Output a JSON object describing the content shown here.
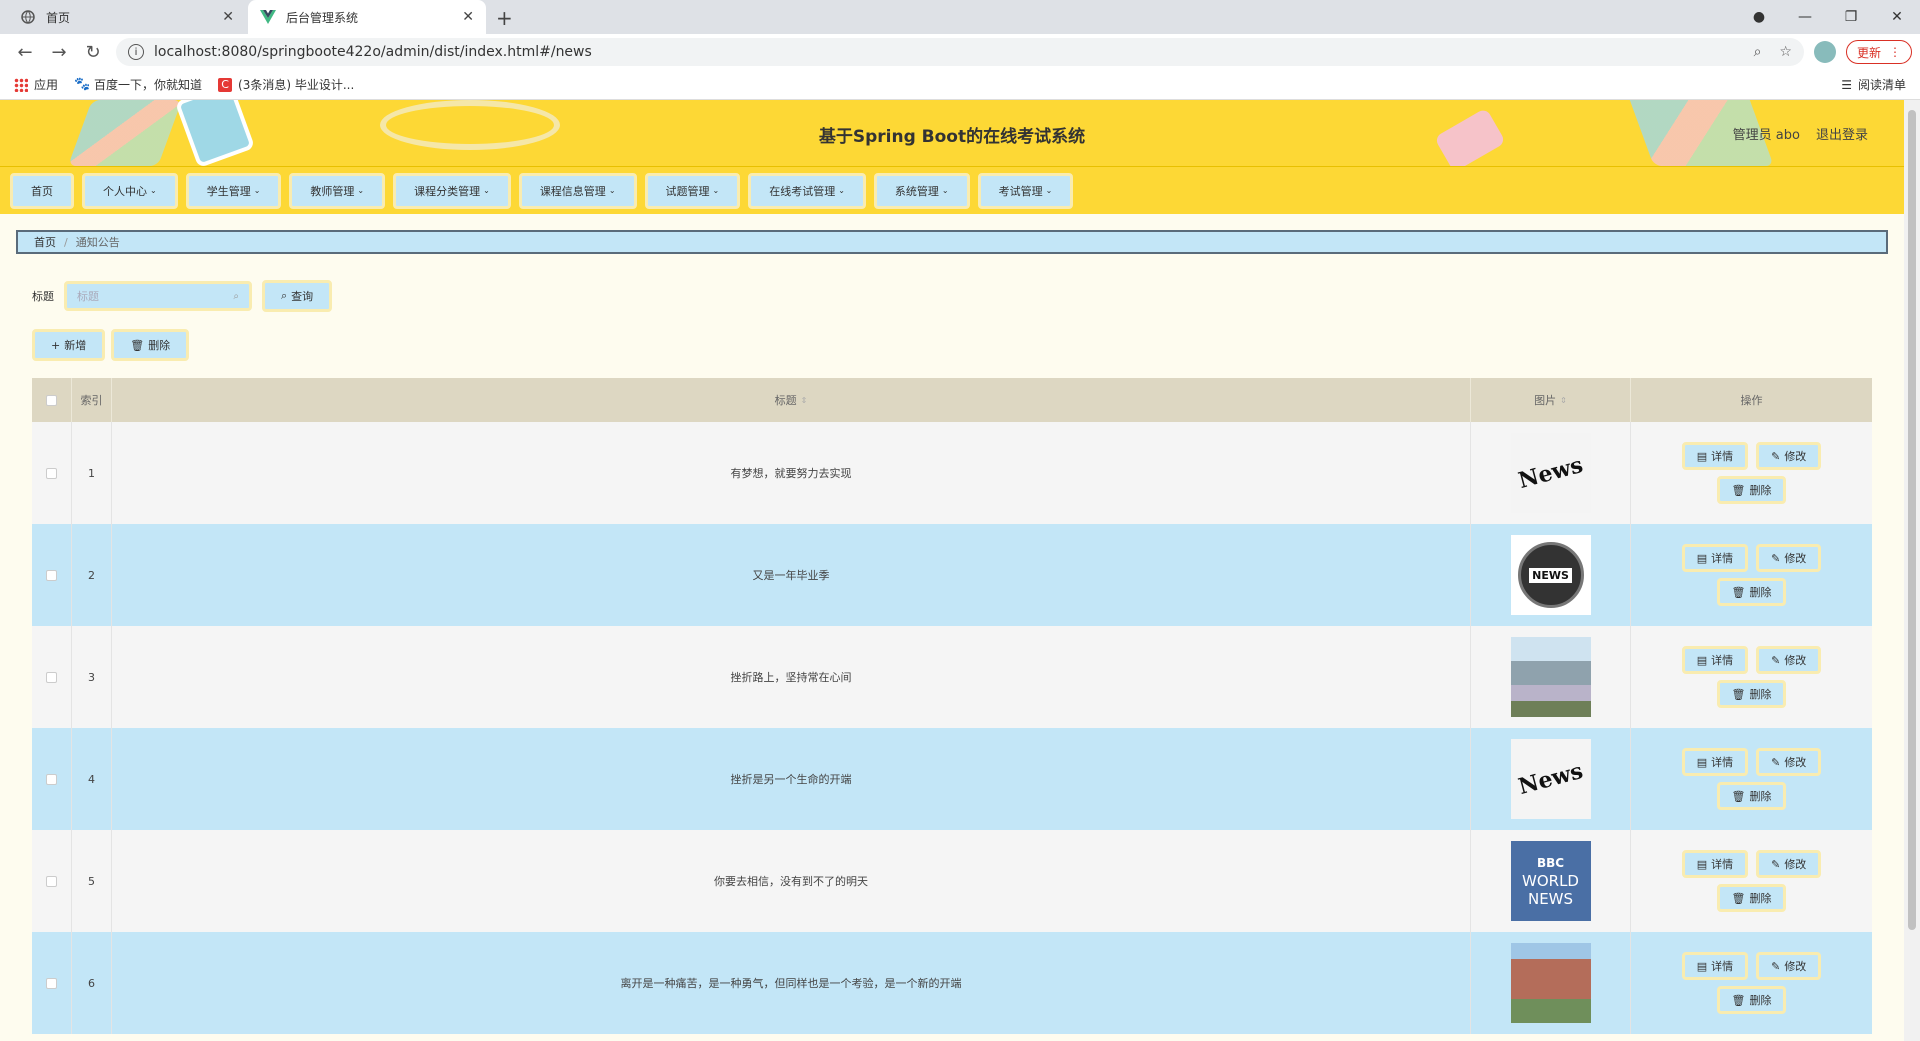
{
  "browser": {
    "tabs": [
      {
        "label": "首页"
      },
      {
        "label": "后台管理系统"
      }
    ],
    "url": "localhost:8080/springboote422o/admin/dist/index.html#/news",
    "update_label": "更新",
    "bookmarks": [
      {
        "label": "应用"
      },
      {
        "label": "百度一下，你就知道"
      },
      {
        "label": "(3条消息) 毕业设计..."
      }
    ],
    "reading_list": "阅读清单"
  },
  "header": {
    "title": "基于Spring Boot的在线考试系统",
    "user": "管理员 abo",
    "logout": "退出登录"
  },
  "menu": [
    {
      "label": "首页",
      "has_caret": false
    },
    {
      "label": "个人中心",
      "has_caret": true
    },
    {
      "label": "学生管理",
      "has_caret": true
    },
    {
      "label": "教师管理",
      "has_caret": true
    },
    {
      "label": "课程分类管理",
      "has_caret": true
    },
    {
      "label": "课程信息管理",
      "has_caret": true
    },
    {
      "label": "试题管理",
      "has_caret": true
    },
    {
      "label": "在线考试管理",
      "has_caret": true
    },
    {
      "label": "系统管理",
      "has_caret": true
    },
    {
      "label": "考试管理",
      "has_caret": true
    }
  ],
  "breadcrumb": {
    "home": "首页",
    "current": "通知公告"
  },
  "search": {
    "label": "标题",
    "placeholder": "标题",
    "button": "查询"
  },
  "actions": {
    "add": "新增",
    "delete": "删除"
  },
  "table": {
    "columns": {
      "index": "索引",
      "title": "标题",
      "image": "图片",
      "ops": "操作"
    },
    "ops": {
      "detail": "详情",
      "edit": "修改",
      "delete": "删除"
    },
    "rows": [
      {
        "index": "1",
        "title": "有梦想，就要努力去实现",
        "image": "news-paper"
      },
      {
        "index": "2",
        "title": "又是一年毕业季",
        "image": "news-globe"
      },
      {
        "index": "3",
        "title": "挫折路上，坚持常在心间",
        "image": "building"
      },
      {
        "index": "4",
        "title": "挫折是另一个生命的开端",
        "image": "news-paper"
      },
      {
        "index": "5",
        "title": "你要去相信，没有到不了的明天",
        "image": "bbc-world-news"
      },
      {
        "index": "6",
        "title": "离开是一种痛苦，是一种勇气，但同样也是一个考验，是一个新的开端",
        "image": "campus"
      }
    ]
  },
  "thumb_text": {
    "news": "News",
    "news_globe": "NEWS",
    "bbc": "BBC",
    "world": "WORLD",
    "news2": "NEWS"
  }
}
